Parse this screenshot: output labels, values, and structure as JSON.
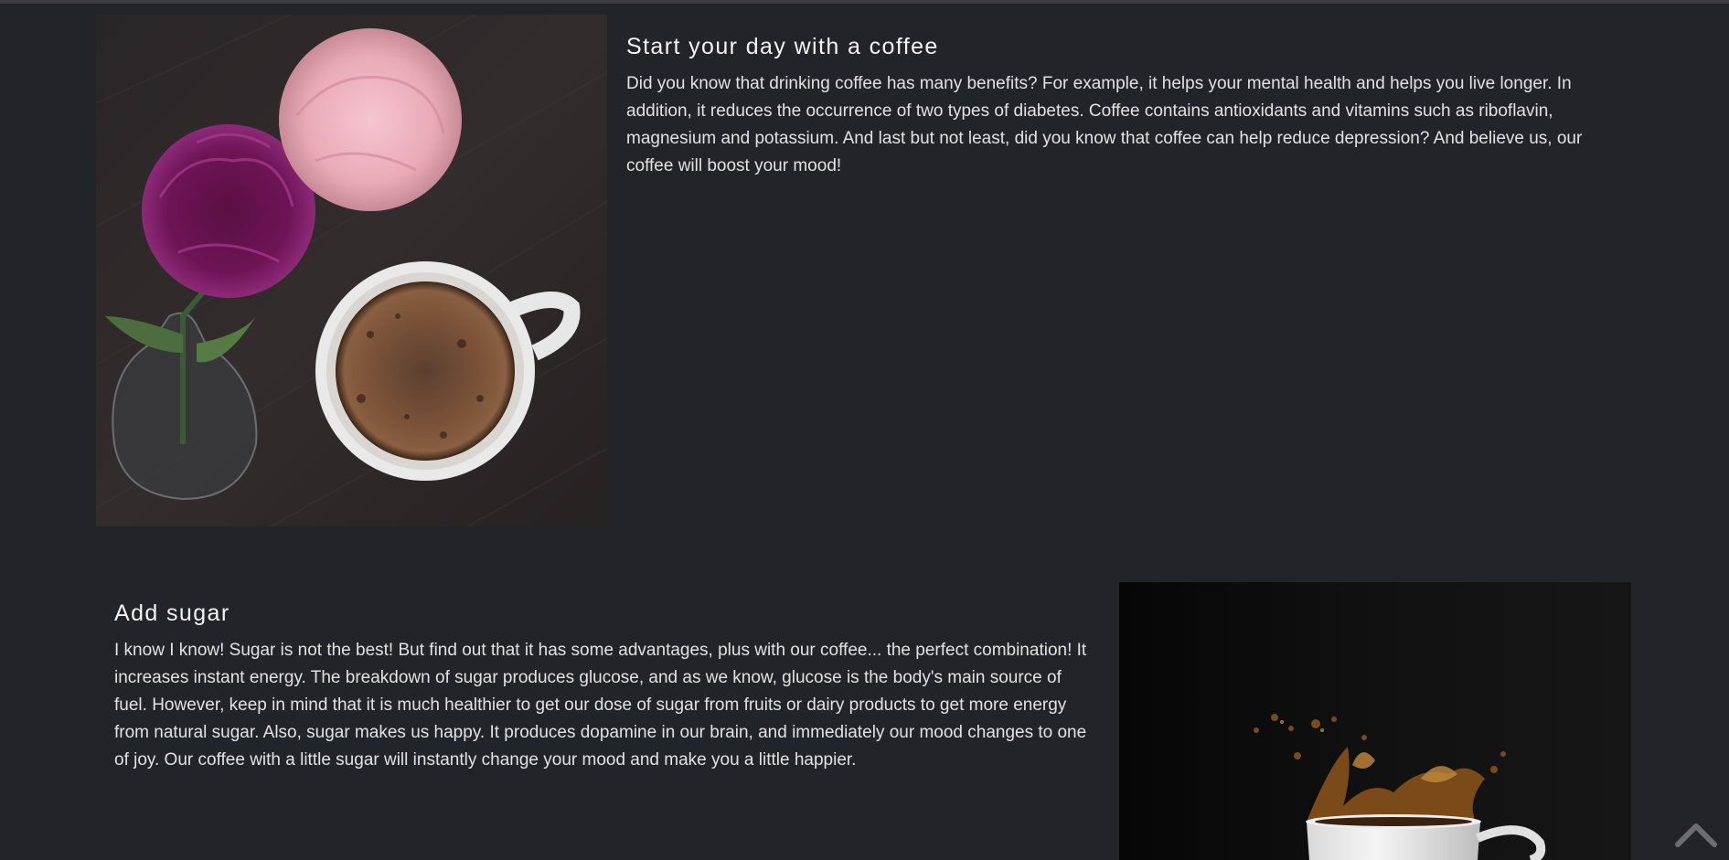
{
  "sections": [
    {
      "title": "Start your day with a coffee",
      "text": "Did you know that drinking coffee has many benefits? For example, it helps your mental health and helps you live longer. In addition, it reduces the occurrence of two types of diabetes. Coffee contains antioxidants and vitamins such as riboflavin, magnesium and potassium. And last but not least, did you know that coffee can help reduce depression? And believe us, our coffee will boost your mood!",
      "image": "coffee-cup-with-carnations-photo"
    },
    {
      "title": "Add sugar",
      "text": "I know I know! Sugar is not the best! But find out that it has some advantages, plus with our coffee... the perfect combination! It increases instant energy. The breakdown of sugar produces glucose, and as we know, glucose is the body's main source of fuel. However, keep in mind that it is much healthier to get our dose of sugar from fruits or dairy products to get more energy from natural sugar. Also, sugar makes us happy. It produces dopamine in our brain, and immediately our mood changes to one of joy. Our coffee with a little sugar will instantly change your mood and make you a little happier.",
      "image": "coffee-splash-cup-photo"
    }
  ],
  "scroll_to_top": {
    "icon": "chevron-up-icon",
    "color": "#6b6d71"
  }
}
